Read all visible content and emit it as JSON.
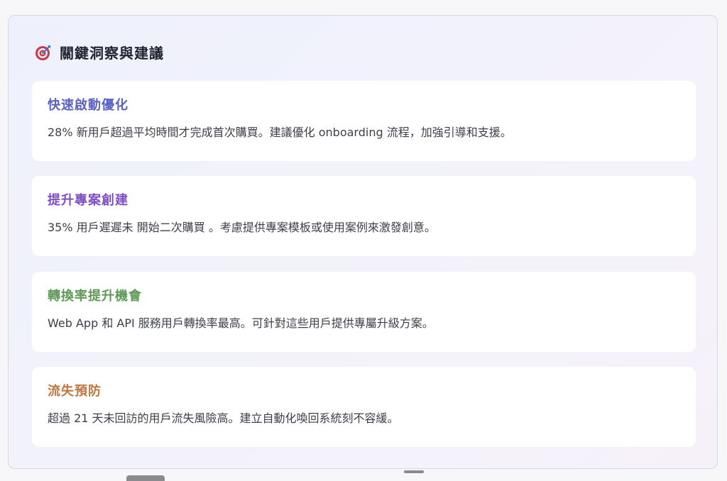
{
  "panel": {
    "title": "關鍵洞察與建議",
    "icon": "target-icon"
  },
  "insights": [
    {
      "title": "快速啟動優化",
      "description": "28% 新用戶超過平均時間才完成首次購買。建議優化 onboarding 流程，加強引導和支援。",
      "color": "#5a62c4"
    },
    {
      "title": "提升專案創建",
      "description": "35% 用戶遲遲未 開始二次購買 。考慮提供專案模板或使用案例來激發創意。",
      "color": "#7e4fc2"
    },
    {
      "title": "轉換率提升機會",
      "description": "Web App 和 API 服務用戶轉換率最高。可針對這些用戶提供專屬升級方案。",
      "color": "#5d9a55"
    },
    {
      "title": "流失預防",
      "description": "超過 21 天未回訪的用戶流失風險高。建立自動化喚回系統刻不容緩。",
      "color": "#c0773f"
    }
  ]
}
